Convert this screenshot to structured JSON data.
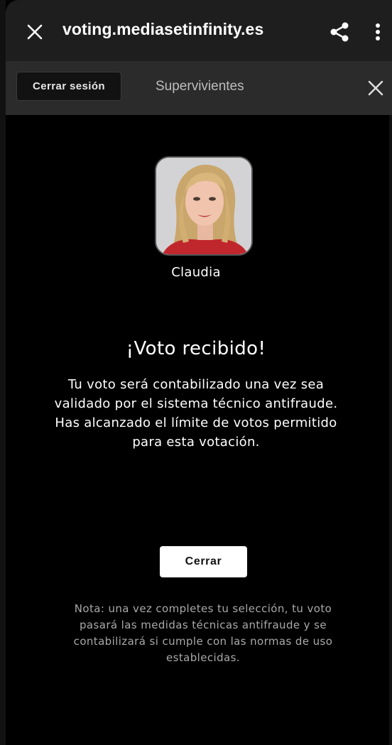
{
  "browser": {
    "url": "voting.mediasetinfinity.es",
    "close_icon": "close-icon",
    "share_icon": "share-icon",
    "menu_icon": "more-vertical-icon"
  },
  "header": {
    "logout_label": "Cerrar sesión",
    "title": "Supervivientes",
    "close_icon": "close-icon"
  },
  "candidate": {
    "name": "Claudia",
    "photo_icon": "candidate-photo"
  },
  "confirmation": {
    "title": "¡Voto recibido!",
    "message": "Tu voto será contabilizado una vez sea validado por el sistema técnico antifraude. Has alcanzado el límite de votos permitido para esta votación.",
    "close_label": "Cerrar"
  },
  "note": "Nota: una vez completes tu selección, tu voto pasará las medidas técnicas antifraude y se contabilizará si cumple con las normas de uso establecidas.",
  "colors": {
    "background": "#000000",
    "browser_bar": "#1e1e1e",
    "header": "#2b2b2b",
    "button": "#ffffff"
  }
}
